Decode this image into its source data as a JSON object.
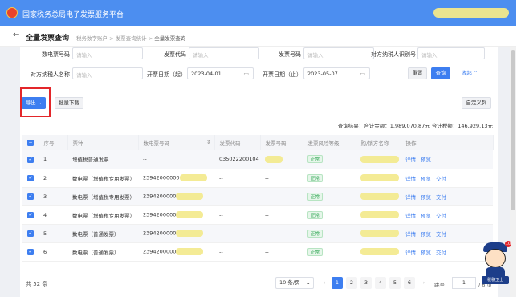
{
  "header": {
    "title": "国家税务总局电子发票服务平台"
  },
  "breadcrumb": {
    "back_icon": "←",
    "page_title": "全量发票查询",
    "items": [
      "税务数字账户",
      "发票查询统计",
      "全量发票查询"
    ],
    "separator": ">"
  },
  "filters": {
    "invoice_no_label": "数电票号码",
    "invoice_no_placeholder": "请输入",
    "invoice_code_label": "发票代码",
    "invoice_code_placeholder": "请输入",
    "invoice_number_label": "发票号码",
    "invoice_number_placeholder": "请输入",
    "counterparty_id_label": "对方纳税人识别号",
    "counterparty_id_placeholder": "请输入",
    "counterparty_name_label": "对方纳税人名称",
    "counterparty_name_placeholder": "请输入",
    "date_start_label": "开票日期（起）",
    "date_start_value": "2023-04-01",
    "date_end_label": "开票日期（止）",
    "date_end_value": "2023-05-07",
    "reset_label": "重置",
    "query_label": "查询",
    "collapse_label": "收起",
    "collapse_icon": "⌃"
  },
  "toolbar": {
    "export_label": "导出",
    "export_icon": "⌄",
    "batch_download_label": "批量下载",
    "custom_columns_label": "自定义列"
  },
  "summary": {
    "text": "查询结果：合计金额：1,989,070.87元  合计税额：146,929.13元"
  },
  "table": {
    "columns": [
      "序号",
      "票种",
      "数电票号码",
      "发票代码",
      "发票号码",
      "发票风险等级",
      "购/销方名称",
      "操作"
    ],
    "rows": [
      {
        "no": "1",
        "type": "增值税普通发票",
        "digital_no": "--",
        "code": "035022200104",
        "number": "",
        "risk": "正常",
        "ops": [
          "详情",
          "预览"
        ]
      },
      {
        "no": "2",
        "type": "数电票（增值税专用发票）",
        "digital_no": "23942000000",
        "code": "--",
        "number": "--",
        "risk": "正常",
        "ops": [
          "详情",
          "预览",
          "交付"
        ]
      },
      {
        "no": "3",
        "type": "数电票（增值税专用发票）",
        "digital_no": "2394200000",
        "code": "--",
        "number": "--",
        "risk": "正常",
        "ops": [
          "详情",
          "预览",
          "交付"
        ]
      },
      {
        "no": "4",
        "type": "数电票（增值税专用发票）",
        "digital_no": "2394200000",
        "code": "--",
        "number": "--",
        "risk": "正常",
        "ops": [
          "详情",
          "预览",
          "交付"
        ]
      },
      {
        "no": "5",
        "type": "数电票（普通发票）",
        "digital_no": "2394200000",
        "code": "--",
        "number": "--",
        "risk": "正常",
        "ops": [
          "详情",
          "预览",
          "交付"
        ]
      },
      {
        "no": "6",
        "type": "数电票（普通发票）",
        "digital_no": "2394200000",
        "code": "--",
        "number": "--",
        "risk": "正常",
        "ops": [
          "详情",
          "预览",
          "交付"
        ]
      }
    ]
  },
  "pagination": {
    "total": "共 52 条",
    "page_size": "10 条/页",
    "pages": [
      "1",
      "2",
      "3",
      "4",
      "5",
      "6"
    ],
    "prev": "‹",
    "next": "›",
    "jump_label": "跳至",
    "jump_value": "1",
    "page_count": "/ 6 页"
  },
  "mascot": {
    "badge": "10",
    "plate": "税税卫士"
  },
  "colors": {
    "brand_blue": "#4c8ef0",
    "primary": "#3d7ef0",
    "highlight_red": "#e3262a",
    "risk_green": "#2aa44f",
    "redaction_yellow": "#f3e98a"
  }
}
